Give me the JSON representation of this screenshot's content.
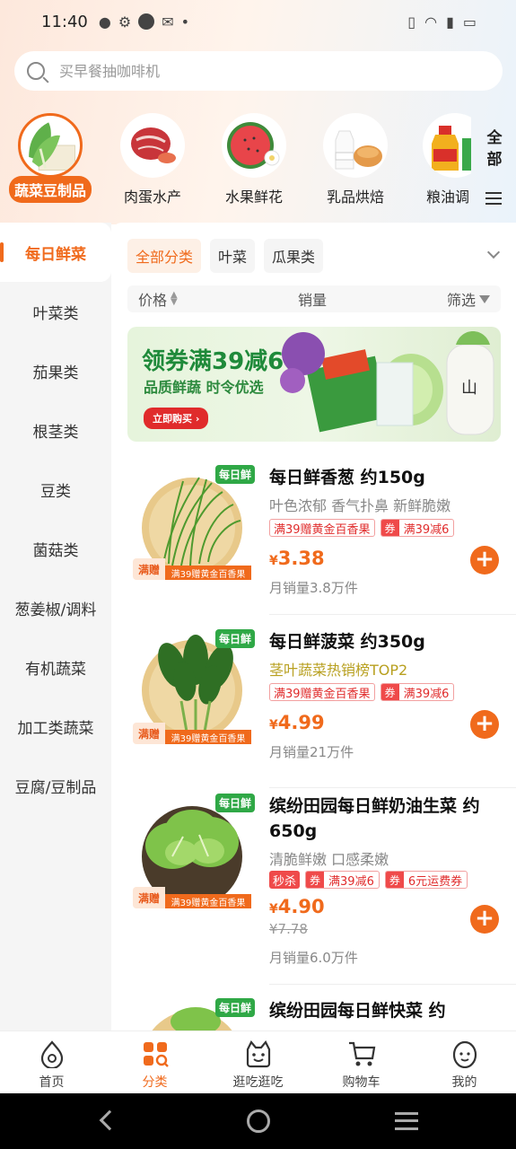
{
  "status_bar": {
    "time": "11:40"
  },
  "search": {
    "placeholder": "买早餐抽咖啡机"
  },
  "categories": [
    {
      "label": "蔬菜豆制品",
      "icon": "vegetables-tofu-icon"
    },
    {
      "label": "肉蛋水产",
      "icon": "meat-icon"
    },
    {
      "label": "水果鲜花",
      "icon": "watermelon-icon"
    },
    {
      "label": "乳品烘焙",
      "icon": "milk-bread-icon"
    },
    {
      "label": "粮油调",
      "icon": "oil-icon"
    }
  ],
  "all_categories_label": "全部",
  "sidebar": [
    {
      "label": "每日鲜菜"
    },
    {
      "label": "叶菜类"
    },
    {
      "label": "茄果类"
    },
    {
      "label": "根茎类"
    },
    {
      "label": "豆类"
    },
    {
      "label": "菌菇类"
    },
    {
      "label": "葱姜椒/调料"
    },
    {
      "label": "有机蔬菜"
    },
    {
      "label": "加工类蔬菜"
    },
    {
      "label": "豆腐/豆制品"
    }
  ],
  "chips": [
    "全部分类",
    "叶菜",
    "瓜果类"
  ],
  "sort": {
    "price": "价格",
    "sales": "销量",
    "filter": "筛选"
  },
  "banner": {
    "title": "领券满39减6",
    "subtitle": "品质鲜蔬 时令优选",
    "button": "立即购买 ›"
  },
  "products": [
    {
      "badge": "每日鲜",
      "promo_left": "满赠",
      "promo_right": "满39赠黄金百香果",
      "name": "每日鲜香葱 约150g",
      "desc": "叶色浓郁 香气扑鼻 新鲜脆嫩",
      "tag_gift": "满39赠黄金百香果",
      "coupon_label": "券",
      "coupon_text": "满39减6",
      "currency": "¥",
      "price": "3.38",
      "sales": "月销量3.8万件"
    },
    {
      "badge": "每日鲜",
      "promo_left": "满赠",
      "promo_right": "满39赠黄金百香果",
      "name": "每日鲜菠菜 约350g",
      "desc": "茎叶蔬菜热销榜TOP2",
      "tag_gift": "满39赠黄金百香果",
      "coupon_label": "券",
      "coupon_text": "满39减6",
      "currency": "¥",
      "price": "4.99",
      "sales": "月销量21万件"
    },
    {
      "badge": "每日鲜",
      "promo_left": "满赠",
      "promo_right": "满39赠黄金百香果",
      "name": "缤纷田园每日鲜奶油生菜 约650g",
      "desc": "清脆鲜嫩 口感柔嫩",
      "flash": "秒杀",
      "coupon_label": "券",
      "coupon_text": "满39减6",
      "coupon2_text": "6元运费券",
      "currency": "¥",
      "price": "4.90",
      "orig_price": "¥7.78",
      "sales": "月销量6.0万件"
    },
    {
      "badge": "每日鲜",
      "name": "缤纷田园每日鲜快菜 约"
    }
  ],
  "tabs": [
    {
      "label": "首页",
      "icon": "home-icon"
    },
    {
      "label": "分类",
      "icon": "category-icon"
    },
    {
      "label": "逛吃逛吃",
      "icon": "explore-icon"
    },
    {
      "label": "购物车",
      "icon": "cart-icon"
    },
    {
      "label": "我的",
      "icon": "profile-icon"
    }
  ],
  "colors": {
    "accent": "#f06a1c",
    "fresh_green": "#2fa846",
    "coupon_red": "#ef4a4a"
  }
}
